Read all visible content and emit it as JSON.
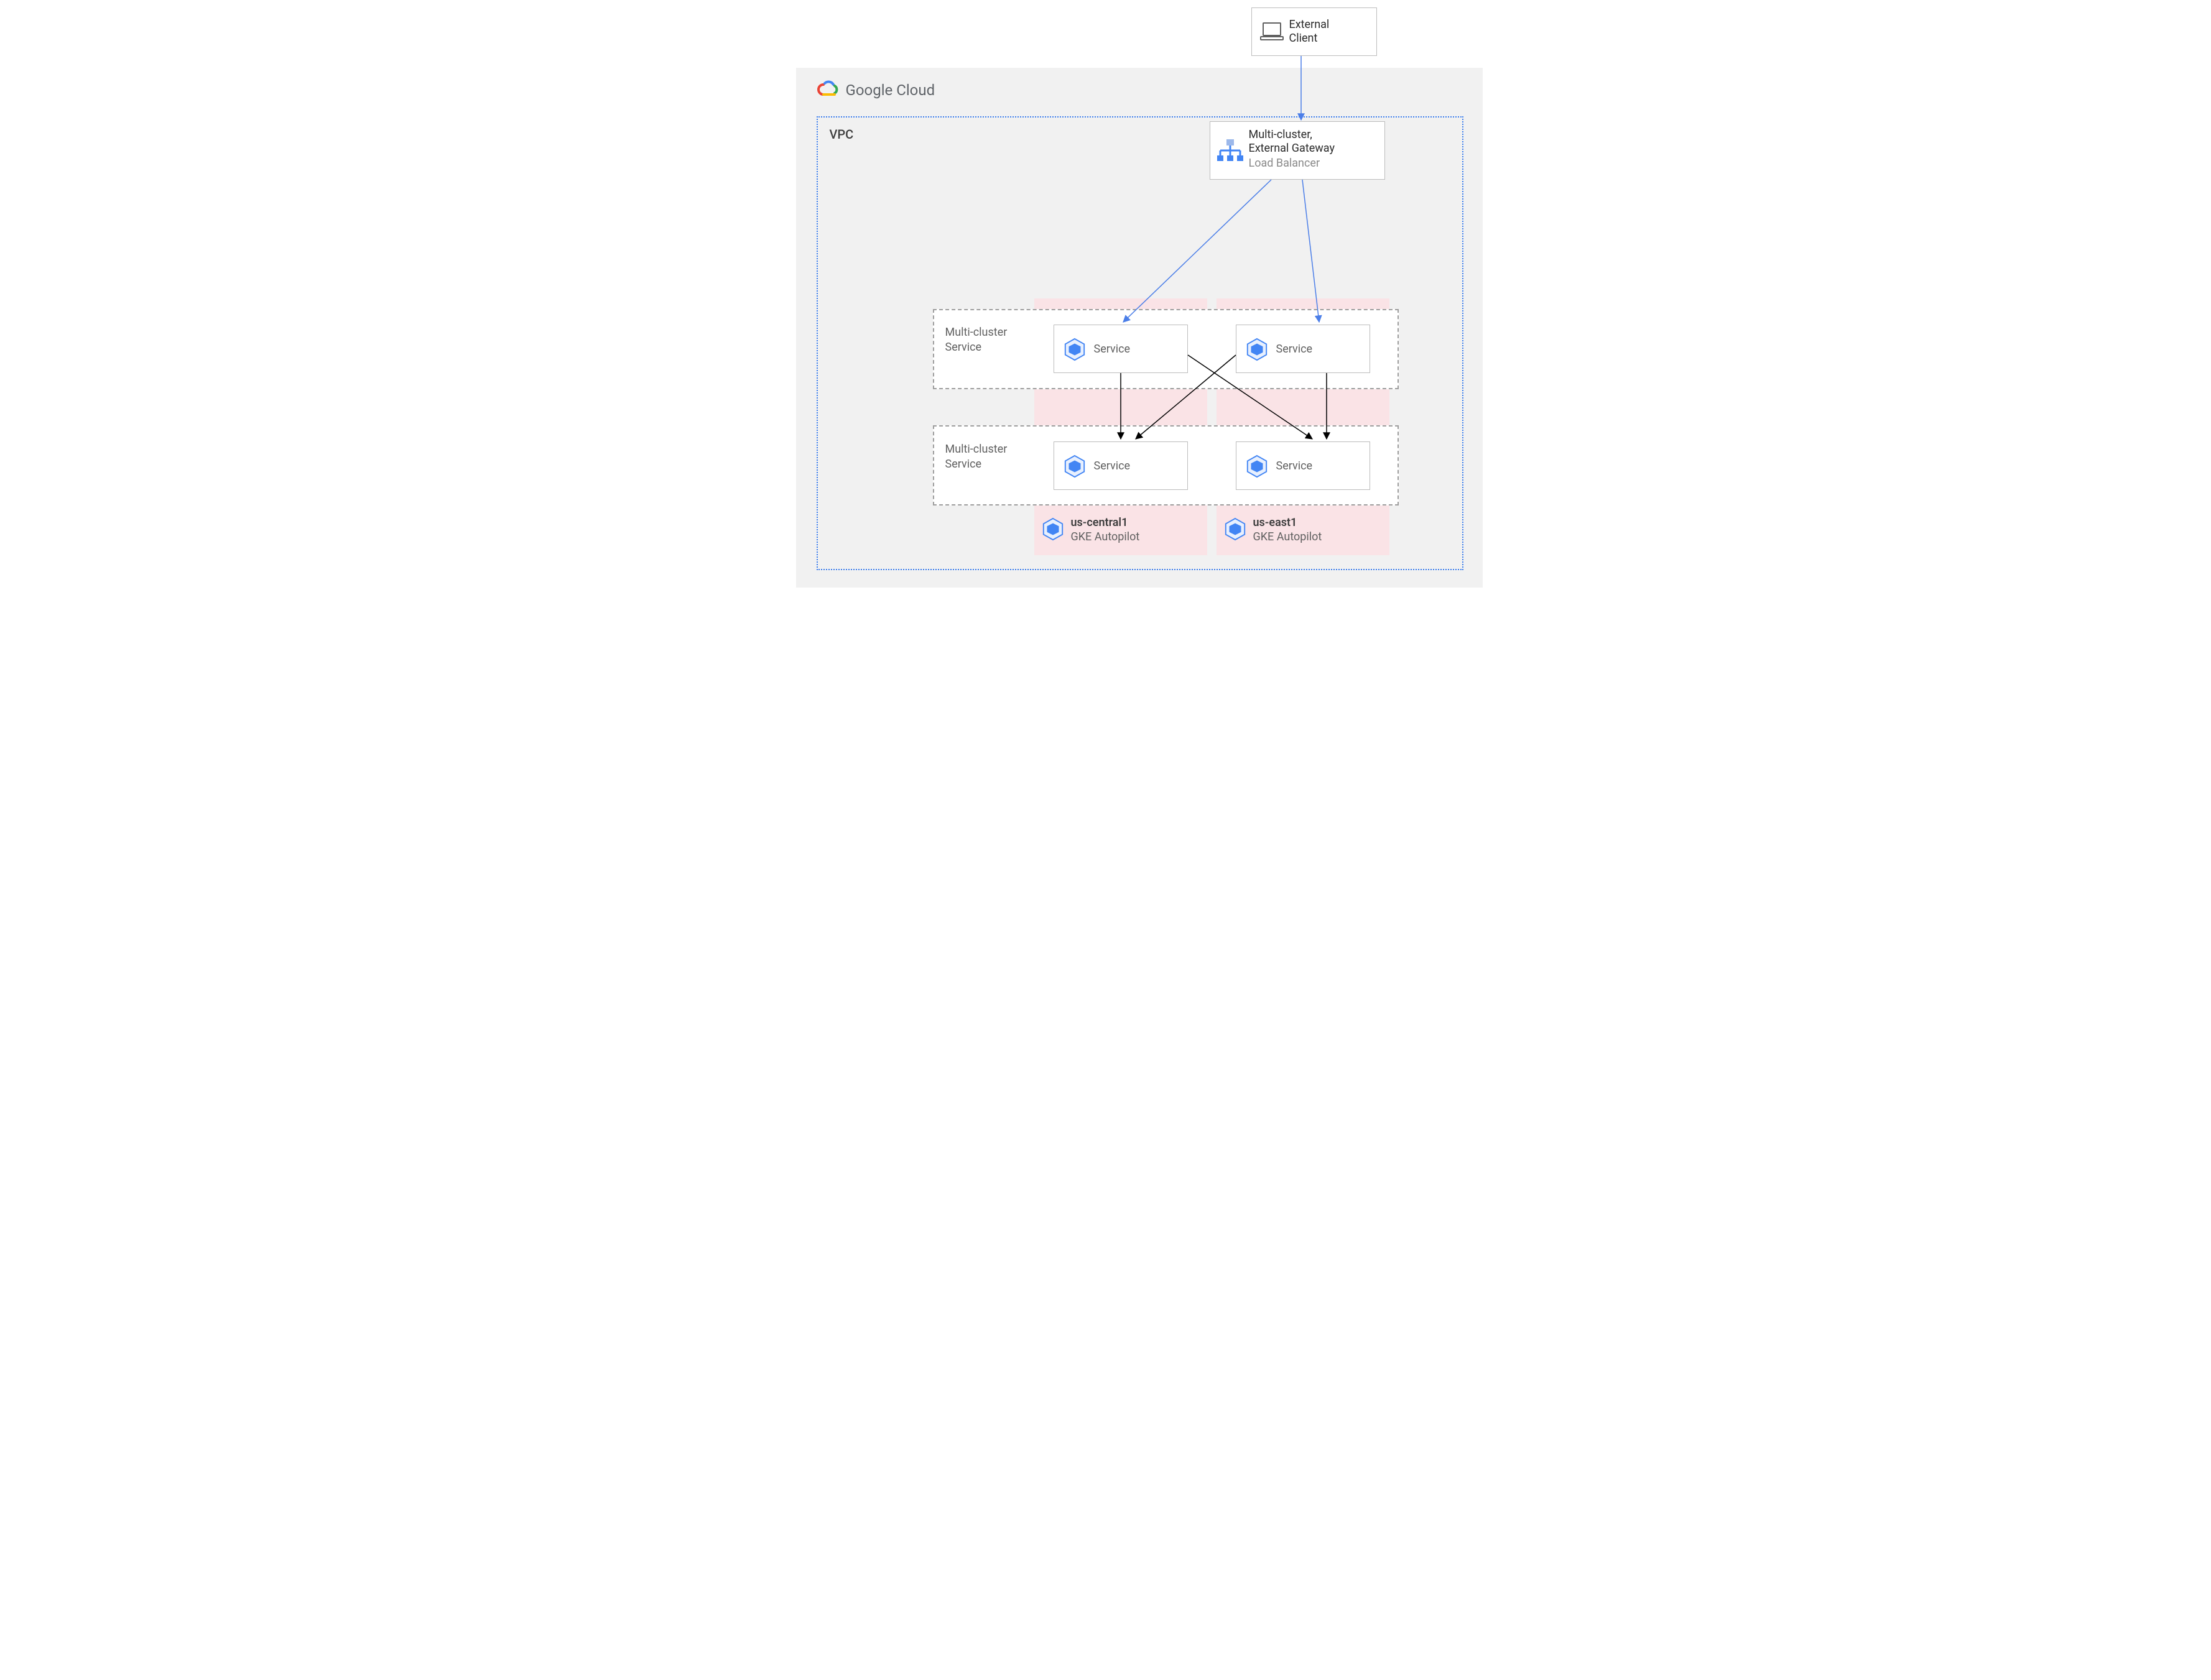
{
  "external": {
    "line1": "External",
    "line2": "Client"
  },
  "gcloud": {
    "brand": "Google Cloud"
  },
  "vpc": {
    "title": "VPC"
  },
  "gateway": {
    "line1": "Multi-cluster,",
    "line2": "External Gateway",
    "line3": "Load Balancer"
  },
  "mcs1": {
    "line1": "Multi-cluster",
    "line2": "Service"
  },
  "mcs2": {
    "line1": "Multi-cluster",
    "line2": "Service"
  },
  "svc": {
    "label": "Service"
  },
  "cluster1": {
    "name": "us-central1",
    "type": "GKE Autopilot"
  },
  "cluster2": {
    "name": "us-east1",
    "type": "GKE Autopilot"
  },
  "icons": {
    "gke_service": "gke-service-icon",
    "gke_cluster": "gke-cluster-icon",
    "load_balancer": "load-balancer-icon",
    "laptop": "laptop-icon",
    "gcloud_logo": "google-cloud-logo"
  },
  "colors": {
    "arrow_blue": "#4b7ee8",
    "arrow_black": "#000000",
    "panel_grey": "#f1f1f1",
    "panel_pink": "#fae3e6",
    "dotted_blue": "#3b7ded",
    "dashed_grey": "#9e9e9e"
  }
}
